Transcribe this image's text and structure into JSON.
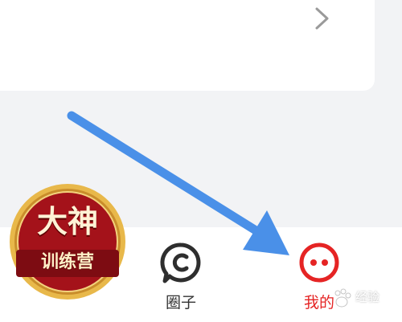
{
  "colors": {
    "page_background": "#f2f3f5",
    "card_background": "#ffffff",
    "active_tab": "#e52424",
    "inactive_tab": "#333333",
    "arrow": "#4a90e8",
    "badge_red": "#a4121a",
    "badge_gold": "#e8b84a"
  },
  "card": {
    "chevron_icon": "chevron-right-icon"
  },
  "tabbar": {
    "tabs": [
      {
        "label": "圈子",
        "icon": "circle-chat-icon",
        "active": false
      },
      {
        "label": "我的",
        "icon": "profile-dots-icon",
        "active": true
      }
    ]
  },
  "badge": {
    "line1": "大神",
    "line2": "训练营"
  },
  "watermark": {
    "text": "经验"
  },
  "annotation": {
    "type": "arrow",
    "points_to": "我的"
  }
}
